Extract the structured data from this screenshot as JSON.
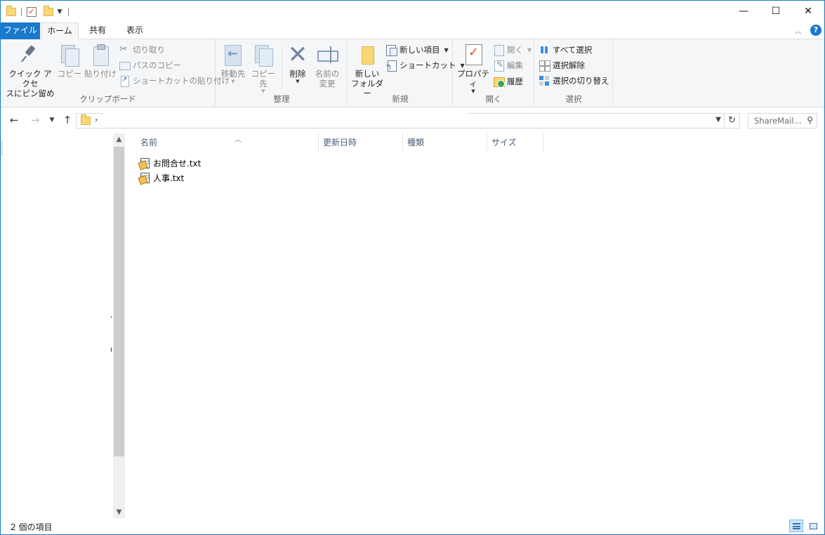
{
  "tabs": {
    "file": "ファイル",
    "home": "ホーム",
    "share": "共有",
    "view": "表示"
  },
  "ribbon": {
    "clipboard": {
      "pin_line1": "クイック アクセ",
      "pin_line2": "スにピン留め",
      "copy": "コピー",
      "paste": "貼り付け",
      "cut": "切り取り",
      "copy_path": "パスのコピー",
      "paste_shortcut": "ショートカットの貼り付け",
      "label": "クリップボード"
    },
    "organize": {
      "move_to": "移動先",
      "copy_to": "コピー先",
      "delete": "削除",
      "rename_line1": "名前の",
      "rename_line2": "変更",
      "label": "整理"
    },
    "new": {
      "new_folder_line1": "新しい",
      "new_folder_line2": "フォルダー",
      "new_item": "新しい項目",
      "easy_access": "ショートカット",
      "label": "新規"
    },
    "open": {
      "properties": "プロパティ",
      "open": "開く",
      "edit": "編集",
      "history": "履歴",
      "label": "開く"
    },
    "select": {
      "select_all": "すべて選択",
      "select_none": "選択解除",
      "invert": "選択の切り替え",
      "label": "選択"
    }
  },
  "address": {
    "search_placeholder": "ShareMail..."
  },
  "columns": {
    "name": "名前",
    "date": "更新日時",
    "type": "種類",
    "size": "サイズ"
  },
  "files": [
    {
      "name": "お問合せ.txt"
    },
    {
      "name": "人事.txt"
    }
  ],
  "status": {
    "count": "2 個の項目"
  }
}
